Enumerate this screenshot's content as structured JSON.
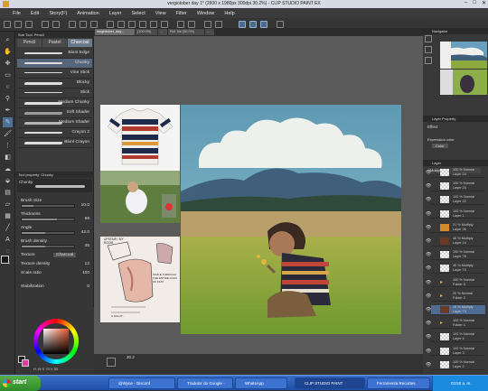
{
  "window": {
    "title": "vergiotober day 1* (2600 x 1980px 300dpi 30.2%) - CLIP STUDIO PAINT EX",
    "min": "–",
    "max": "□",
    "close": "✕"
  },
  "menu": [
    "File",
    "Edit",
    "Story(F)",
    "Animation",
    "Layer",
    "Select",
    "View",
    "Filter",
    "Window",
    "Help"
  ],
  "canvas_tabs": [
    "vergiotober_day...",
    "(100.0%)",
    "...",
    "Ref. file (50.0%)",
    "..."
  ],
  "subtool": {
    "header": "Sub Tool: Pencil",
    "tabs": [
      "Pencil",
      "Pastel",
      "Charcoal"
    ],
    "brushes": [
      "Blunt Edge",
      "Chunky",
      "Vine Stick",
      "Blocky",
      "Slick",
      "Medium Chunky",
      "Soft Shader",
      "Medium Shader",
      "Crayon 2",
      "Blunt Crayon"
    ]
  },
  "toolprop": {
    "header": "Tool property: Chunky",
    "name": "Chunky",
    "rows": [
      {
        "label": "Brush Size",
        "value": "10.0",
        "fill": 0.22
      },
      {
        "label": "Thickness",
        "value": "68",
        "fill": 0.68
      },
      {
        "label": "Angle",
        "value": "42.0",
        "fill": 0.45
      },
      {
        "label": "Brush density",
        "value": "45",
        "fill": 0.45
      }
    ],
    "texture_label": "Texture",
    "texture_value": "Charcoal",
    "texture_density_label": "Texture density",
    "texture_density_value": "12",
    "scale_label": "Scale ratio",
    "scale_value": "100",
    "stabilization_label": "Stabilization",
    "stabilization_value": "0"
  },
  "color": {
    "fg": "#1a1a1a",
    "bg": "#e03ca8",
    "current": "#8a3a28",
    "values": "H 15  S 70  V 55"
  },
  "ref_text": {
    "note1": "UPSTAIR / MY ROOM",
    "note2": "SCALE THROUGH THE ENTIRE FOLD OF FLAT",
    "note3": "A SOLUT..."
  },
  "bottombar": {
    "zoom": "30.2"
  },
  "right": {
    "navigator": "Navigator",
    "layer_property": "Layer Property",
    "effect": "Effect",
    "expression_color": "Expression color",
    "color_label": "Color",
    "layer_header": "Layer",
    "layers": [
      {
        "mode": "100 % Normal",
        "name": "Layer 24",
        "thumb": "chk"
      },
      {
        "mode": "100 % Normal",
        "name": "Layer 23",
        "thumb": "chk"
      },
      {
        "mode": "100 % Normal",
        "name": "Layer 22",
        "thumb": "chk"
      },
      {
        "mode": "100 % Normal",
        "name": "Layer 1",
        "thumb": "chk"
      },
      {
        "mode": "21 % Multiply",
        "name": "Layer 26",
        "thumb": "orange"
      },
      {
        "mode": "45 % Multiply",
        "name": "Layer 14",
        "thumb": "brown"
      },
      {
        "mode": "100 % Normal",
        "name": "Layer 78",
        "thumb": "chk"
      },
      {
        "mode": "45 % Multiply",
        "name": "Layer 74",
        "thumb": "chk"
      },
      {
        "mode": "100 % Normal",
        "name": "Folder 5",
        "thumb": "folder"
      },
      {
        "mode": "20 % Normal",
        "name": "Folder 2",
        "thumb": "folder"
      },
      {
        "mode": "15 % Multiply",
        "name": "Layer 73",
        "thumb": "brown",
        "selected": true
      },
      {
        "mode": "100 % Normal",
        "name": "Folder 1",
        "thumb": "folder"
      },
      {
        "mode": "100 % Normal",
        "name": "Layer 4",
        "thumb": "chk"
      },
      {
        "mode": "100 % Normal",
        "name": "Layer 3",
        "thumb": "chk"
      },
      {
        "mode": "100 % Normal",
        "name": "Layer 2",
        "thumb": "chk"
      }
    ]
  },
  "taskbar": {
    "start": "start",
    "tasks": [
      "@Wyne - Discord",
      "Tradutor do Google -",
      "WhatsApp",
      "CLIP STUDIO PAINT",
      "Ferramenta Recortes"
    ],
    "time": "03:50 a. m."
  }
}
